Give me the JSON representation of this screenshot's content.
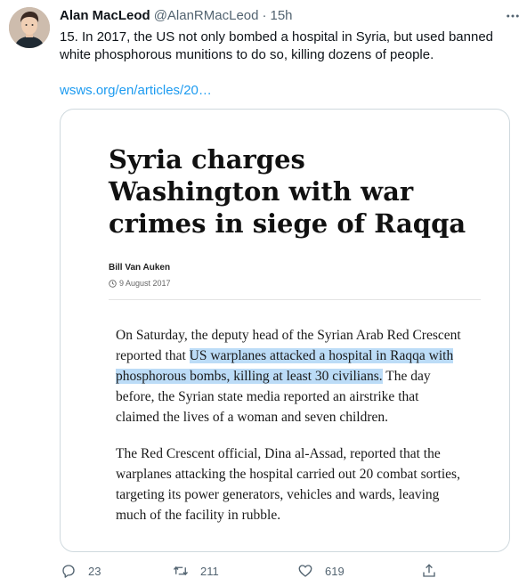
{
  "tweet": {
    "author_name": "Alan MacLeod",
    "author_handle": "@AlanRMacLeod",
    "separator": "·",
    "time": "15h",
    "text": "15. In 2017, the US not only bombed a  hospital in Syria, but used banned white phosphorous munitions to do so, killing dozens of people.",
    "link_text": "wsws.org/en/articles/20…"
  },
  "card": {
    "title": "Syria charges Washington with war crimes in siege of Raqqa",
    "author": "Bill Van Auken",
    "date": "9 August 2017",
    "para1_before": "On Saturday, the deputy head of the Syrian Arab Red Crescent reported that ",
    "para1_highlight": "US warplanes attacked a hospital in Raqqa with phosphorous bombs, killing at least 30 civilians.",
    "para1_after": " The day before, the Syrian state media reported an airstrike that claimed the lives of a woman and seven children.",
    "para2": "The Red Crescent official, Dina al-Assad, reported that the warplanes attacking the hospital carried out 20 combat sorties, targeting its power generators, vehicles and wards, leaving much of the facility in rubble."
  },
  "actions": {
    "reply_count": "23",
    "retweet_count": "211",
    "like_count": "619",
    "reply_icon": "reply-icon",
    "retweet_icon": "retweet-icon",
    "like_icon": "heart-icon",
    "share_icon": "share-icon"
  },
  "colors": {
    "text_primary": "#0f1419",
    "text_secondary": "#536471",
    "link": "#1d9bf0",
    "highlight": "#bcdcf7",
    "border": "#cfd9de"
  }
}
